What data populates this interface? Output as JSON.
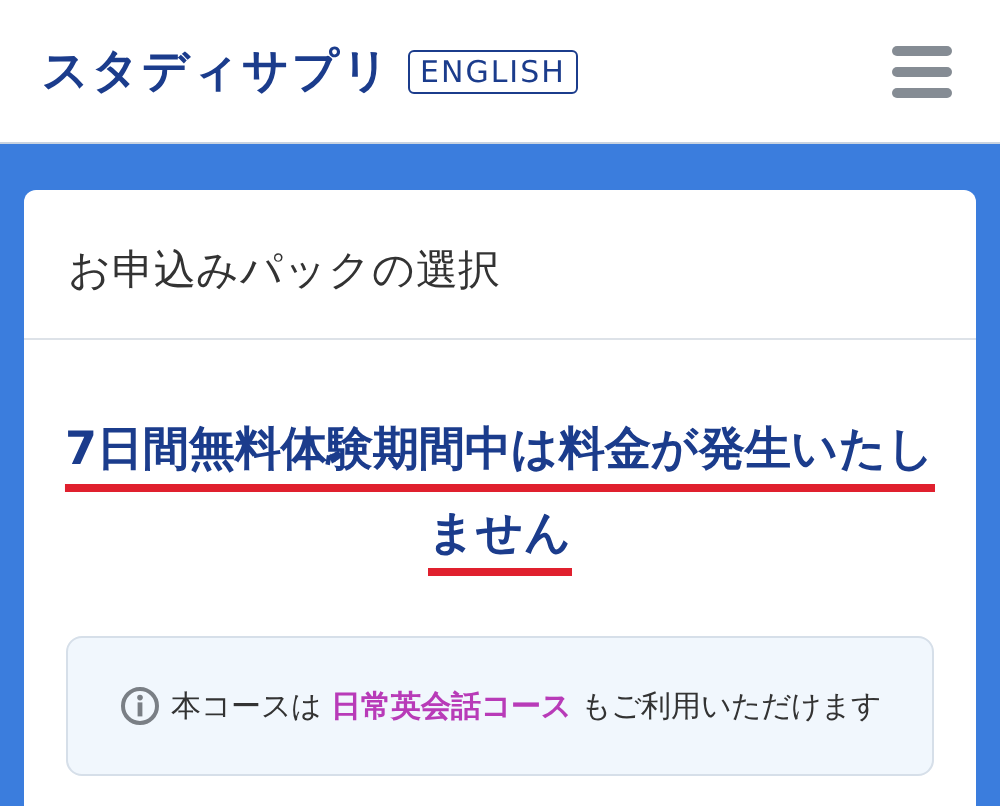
{
  "header": {
    "logo": "スタディサプリ",
    "logo_badge": "ENGLISH"
  },
  "card": {
    "title": "お申込みパックの選択",
    "headline": "7日間無料体験期間中は料金が発生いたしません",
    "info": "本コースは **日常英会話コース** もご利用いただけます"
  }
}
